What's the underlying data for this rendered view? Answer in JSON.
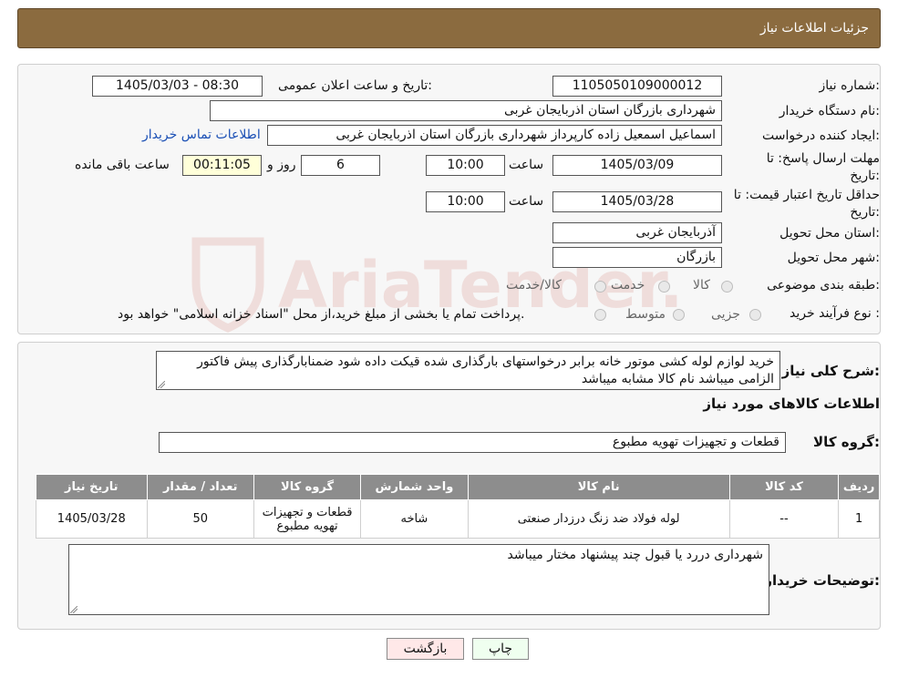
{
  "header": {
    "title": "جزئیات اطلاعات نیاز"
  },
  "fields": {
    "need_number_label": "شماره نیاز:",
    "need_number": "1105050109000012",
    "announce_label": "تاریخ و ساعت اعلان عمومی:",
    "announce_value": "1405/03/03 - 08:30",
    "buyer_org_label": "نام دستگاه خریدار:",
    "buyer_org": "شهرداری بازرگان استان اذربایجان غربی",
    "requester_label": "ایجاد کننده درخواست:",
    "requester": "اسماعیل اسمعیل زاده کارپرداز شهرداری بازرگان استان اذربایجان غربی",
    "contact_link": "اطلاعات تماس خریدار",
    "deadline_label_1": "مهلت ارسال پاسخ: تا",
    "deadline_label_2": "تاریخ:",
    "deadline_date": "1405/03/09",
    "time_label": "ساعت",
    "deadline_time": "10:00",
    "days_value": "6",
    "days_label": "روز و",
    "remaining_time": "00:11:05",
    "remaining_label": "ساعت باقی مانده",
    "validity_label_1": "حداقل تاریخ اعتبار قیمت: تا",
    "validity_label_2": "تاریخ:",
    "validity_date": "1405/03/28",
    "validity_time": "10:00",
    "province_label": "استان محل تحویل:",
    "province": "آذربایجان غربی",
    "city_label": "شهر محل تحویل:",
    "city": "بازرگان",
    "category_label": "طبقه بندی موضوعی:",
    "category_options": [
      "کالا",
      "خدمت",
      "کالا/خدمت"
    ],
    "process_label": "نوع فرآیند خرید :",
    "process_options": [
      "جزیی",
      "متوسط"
    ],
    "process_note": "پرداخت تمام یا بخشی از مبلغ خرید،از محل \"اسناد خزانه اسلامی\" خواهد بود."
  },
  "description": {
    "label": "شرح کلی نیاز:",
    "text": "خرید لوازم لوله کشی موتور خانه برابر درخواستهای بارگذاری شده قیکت داده شود ضمنابارگذاری پیش فاکتور الزامی میباشد نام کالا مشابه میباشد"
  },
  "items_section": {
    "title": "اطلاعات کالاهای مورد نیاز",
    "group_label": "گروه کالا:",
    "group_value": "قطعات و تجهیزات تهویه مطبوع",
    "columns": [
      "ردیف",
      "کد کالا",
      "نام کالا",
      "واحد شمارش",
      "گروه کالا",
      "تعداد / مقدار",
      "تاریخ نیاز"
    ],
    "rows": [
      [
        "1",
        "--",
        "لوله فولاد ضد زنگ درزدار صنعتی",
        "شاخه",
        "قطعات و تجهیزات تهویه مطبوع",
        "50",
        "1405/03/28"
      ]
    ]
  },
  "buyer_notes": {
    "label": "توضیحات خریدار:",
    "text": "شهرداری دررد یا قبول چند پیشنهاد مختار میباشد"
  },
  "buttons": {
    "print": "چاپ",
    "back": "بازگشت"
  },
  "watermark": {
    "text": "AriaTender.neT",
    "color": "#c0392b"
  }
}
